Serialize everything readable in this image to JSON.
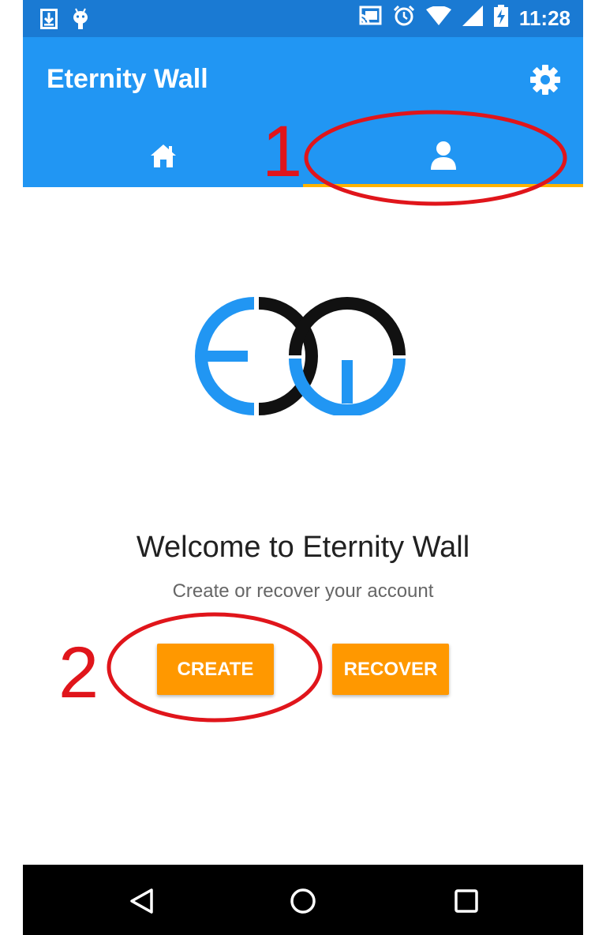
{
  "status_bar": {
    "time": "11:28",
    "icons": [
      "download-icon",
      "android-icon",
      "cast-icon",
      "alarm-icon",
      "wifi-icon",
      "signal-icon",
      "battery-charging-icon"
    ]
  },
  "app_bar": {
    "title": "Eternity Wall",
    "settings_icon": "gear-icon",
    "tabs": [
      {
        "name": "home",
        "icon": "home-icon",
        "selected": false
      },
      {
        "name": "account",
        "icon": "person-icon",
        "selected": true
      }
    ],
    "color": "#2196f3",
    "indicator_color": "#ffb300"
  },
  "main": {
    "welcome_title": "Welcome to Eternity Wall",
    "subtitle": "Create or recover your account",
    "create_label": "CREATE",
    "recover_label": "RECOVER",
    "button_color": "#ff9800"
  },
  "annotations": {
    "label_1": "1",
    "label_2": "2",
    "color": "#e0151b"
  },
  "nav_bar": {
    "icons": [
      "back-icon",
      "home-circle-icon",
      "recents-icon"
    ]
  }
}
